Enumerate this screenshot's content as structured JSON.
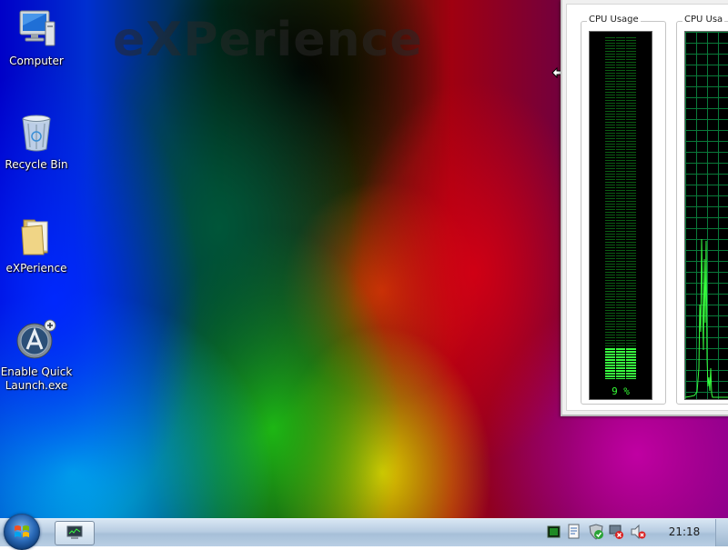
{
  "wallpaper": {
    "brand_text": "eXPerience"
  },
  "desktop_icons": [
    {
      "label": "Computer",
      "icon": "computer-icon"
    },
    {
      "label": "Recycle Bin",
      "icon": "recycle-bin-icon"
    },
    {
      "label": "eXPerience",
      "icon": "folder-icon"
    },
    {
      "label": "Enable Quick Launch.exe",
      "icon": "app-launcher-icon"
    }
  ],
  "gadget": {
    "usage_title": "CPU Usage",
    "usage_value": "9 %",
    "usage_fraction": 0.09,
    "history_title": "CPU Usa"
  },
  "taskbar": {
    "clock": "21:18",
    "tray_icons": [
      "task-manager-tray-icon",
      "document-tray-icon",
      "security-check-tray-icon",
      "network-error-tray-icon",
      "volume-muted-tray-icon"
    ]
  },
  "colors": {
    "meter_green": "#37ff3f",
    "grid_green": "#0a7a3a"
  }
}
